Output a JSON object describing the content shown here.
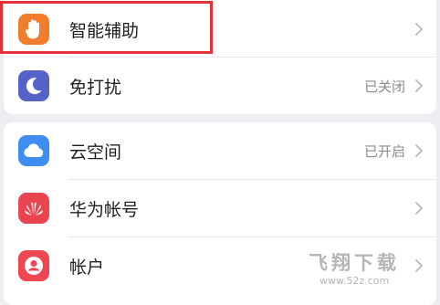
{
  "groups": [
    {
      "rows": [
        {
          "label": "智能辅助",
          "value": "",
          "icon": "hand-icon",
          "icon_color": "#F07D2C"
        },
        {
          "label": "免打扰",
          "value": "已关闭",
          "icon": "moon-icon",
          "icon_color": "#5563C9"
        }
      ]
    },
    {
      "rows": [
        {
          "label": "云空间",
          "value": "已开启",
          "icon": "cloud-icon",
          "icon_color": "#3F8DF1"
        },
        {
          "label": "华为帐号",
          "value": "",
          "icon": "huawei-logo-icon",
          "icon_color": "#EA4450"
        },
        {
          "label": "帐户",
          "value": "",
          "icon": "user-icon",
          "icon_color": "#EE4652"
        }
      ]
    }
  ],
  "highlight_color": "#E4323A",
  "watermark": {
    "title": "飞翔下载",
    "url": "www.52z.com"
  }
}
